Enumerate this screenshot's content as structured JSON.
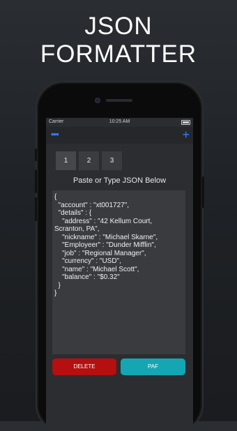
{
  "headline": {
    "line1": "JSON",
    "line2": "FORMATTER"
  },
  "status_bar": {
    "carrier": "Carrier",
    "time": "10:25 AM"
  },
  "navbar": {
    "more_icon": "ellipsis-icon",
    "add_icon": "plus-icon",
    "accent": "#2f80ff"
  },
  "tabs": [
    {
      "label": "1",
      "selected": true
    },
    {
      "label": "2",
      "selected": false
    },
    {
      "label": "3",
      "selected": false
    }
  ],
  "prompt": "Paste or Type JSON Below",
  "editor": {
    "value": "{\n  \"account\" : \"xt001727\",\n  \"details\" : {\n    \"address\" : \"42 Kellum Court,\nScranton, PA\",\n    \"nickname\" : \"Michael Skarne\",\n    \"Employeer\" : \"Dunder Mifflin\",\n    \"job\" : \"Regional Manager\",\n    \"currency\" : \"USD\",\n    \"name\" : \"Michael Scott\",\n    \"balance\" : \"$0.32\"\n  }\n}"
  },
  "buttons": {
    "delete_label": "DELETE",
    "paf_label": "PAF",
    "delete_color": "#b50f0f",
    "paf_color": "#14a7b3"
  }
}
